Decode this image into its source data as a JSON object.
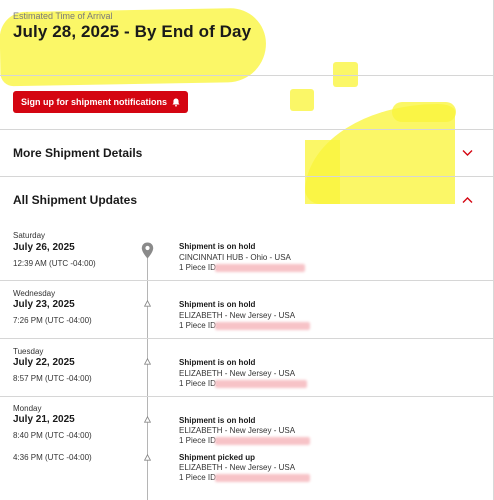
{
  "eta": {
    "label": "Estimated Time of Arrival",
    "value": "July 28, 2025 - By End of Day"
  },
  "notify_button": {
    "label": "Sign up for shipment notifications",
    "icon": "bell-icon"
  },
  "sections": {
    "more_details": {
      "title": "More Shipment Details",
      "state": "collapsed"
    },
    "all_updates": {
      "title": "All Shipment Updates",
      "state": "expanded"
    }
  },
  "updates": [
    {
      "day": "Saturday",
      "date": "July 26, 2025",
      "events": [
        {
          "time": "12:39 AM (UTC -04:00)",
          "title": "Shipment is on hold",
          "location": "CINCINNATI HUB - Ohio - USA",
          "piece_label": "1 Piece ID:"
        }
      ]
    },
    {
      "day": "Wednesday",
      "date": "July 23, 2025",
      "events": [
        {
          "time": "7:26 PM (UTC -04:00)",
          "title": "Shipment is on hold",
          "location": "ELIZABETH - New Jersey - USA",
          "piece_label": "1 Piece ID:"
        }
      ]
    },
    {
      "day": "Tuesday",
      "date": "July 22, 2025",
      "events": [
        {
          "time": "8:57 PM (UTC -04:00)",
          "title": "Shipment is on hold",
          "location": "ELIZABETH - New Jersey - USA",
          "piece_label": "1 Piece ID:"
        }
      ]
    },
    {
      "day": "Monday",
      "date": "July 21, 2025",
      "events": [
        {
          "time": "8:40 PM (UTC -04:00)",
          "title": "Shipment is on hold",
          "location": "ELIZABETH - New Jersey - USA",
          "piece_label": "1 Piece ID:"
        },
        {
          "time": "4:36 PM (UTC -04:00)",
          "title": "Shipment picked up",
          "location": "ELIZABETH - New Jersey - USA",
          "piece_label": "1 Piece ID:"
        }
      ]
    }
  ],
  "colors": {
    "accent": "#d40511",
    "highlight": "#faf53c",
    "timeline": "#b5b5b5"
  }
}
